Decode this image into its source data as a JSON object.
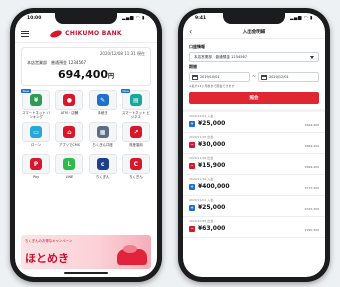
{
  "left_phone": {
    "status_time": "10:00",
    "status_signal": "▂▄▆ ◠ ▮",
    "brand_name": "CHIKUMO BANK",
    "balance_date": "2020/12/08 11:31 現在",
    "account_line": "本店営業部　普通預金 1234567",
    "balance_amount": "694,400",
    "balance_unit": "円",
    "menu_items": [
      {
        "label": "スマートネット\nバンキング",
        "color": "#2f9a52",
        "symbol": "¥",
        "badge": "New",
        "icon": "bank-transfer-icon"
      },
      {
        "label": "ATM・店舗",
        "color": "#d7182a",
        "symbol": "●",
        "badge": "",
        "icon": "map-pin-icon"
      },
      {
        "label": "手続き",
        "color": "#1e6fd0",
        "symbol": "✎",
        "badge": "",
        "icon": "procedure-icon"
      },
      {
        "label": "スマートネット\nビジネス",
        "color": "#18a89b",
        "symbol": "▤",
        "badge": "New",
        "icon": "business-icon"
      },
      {
        "label": "ローン",
        "color": "#2aa7d9",
        "symbol": "▭",
        "badge": "",
        "icon": "card-icon"
      },
      {
        "label": "アプリでCMS",
        "color": "#d7182a",
        "symbol": "⌂",
        "badge": "",
        "icon": "house-icon"
      },
      {
        "label": "ちくぎん口座",
        "color": "#5a6f87",
        "symbol": "▦",
        "badge": "",
        "icon": "account-icon"
      },
      {
        "label": "資産運用",
        "color": "#d7182a",
        "symbol": "↗",
        "badge": "",
        "icon": "chart-icon"
      },
      {
        "label": "Pay",
        "color": "#d7182a",
        "symbol": "P",
        "badge": "",
        "icon": "pay-icon"
      },
      {
        "label": "LINE",
        "color": "#2dbb4b",
        "symbol": "L",
        "badge": "",
        "icon": "line-icon"
      },
      {
        "label": "ちくぎん",
        "color": "#1e3f8c",
        "symbol": "c",
        "badge": "",
        "icon": "app-icon"
      },
      {
        "label": "ちくぎん",
        "color": "#d7182a",
        "symbol": "C",
        "badge": "",
        "icon": "logo-icon"
      }
    ],
    "banner_small": "ちくぎんのお得なキャンペーン",
    "banner_big": "ほとめき"
  },
  "right_phone": {
    "status_time": "9:41",
    "status_signal": "▂▄▆ ◠ ▮",
    "nav_title": "入出金明細",
    "account_label": "口座情報",
    "account_value": "本店営業部　普通預金 1234567",
    "period_label": "期間",
    "date_from": "2019/10/01",
    "date_to": "2020/12/01",
    "note": "※最大13ヶ月前まで照会できます",
    "search_button": "照会",
    "transactions": [
      {
        "date": "2020/12/01 入金",
        "amount": "¥25,000",
        "balance": "¥694,400",
        "type": "in",
        "color": "#1e6fd0",
        "symbol": "+"
      },
      {
        "date": "2020/11/25 出金",
        "amount": "¥30,000",
        "balance": "¥669,400",
        "type": "out",
        "color": "#d7182a",
        "symbol": "−"
      },
      {
        "date": "2020/11/20 出金",
        "amount": "¥15,900",
        "balance": "¥699,400",
        "type": "out",
        "color": "#d7182a",
        "symbol": "−"
      },
      {
        "date": "2020/11/10 入金",
        "amount": "¥400,000",
        "balance": "¥715,300",
        "type": "in",
        "color": "#1e6fd0",
        "symbol": "+"
      },
      {
        "date": "2020/11/01 入金",
        "amount": "¥25,000",
        "balance": "¥315,300",
        "type": "in",
        "color": "#1e6fd0",
        "symbol": "+"
      },
      {
        "date": "2020/10/25 出金",
        "amount": "¥63,000",
        "balance": "¥290,300",
        "type": "out",
        "color": "#d7182a",
        "symbol": "−"
      }
    ]
  }
}
